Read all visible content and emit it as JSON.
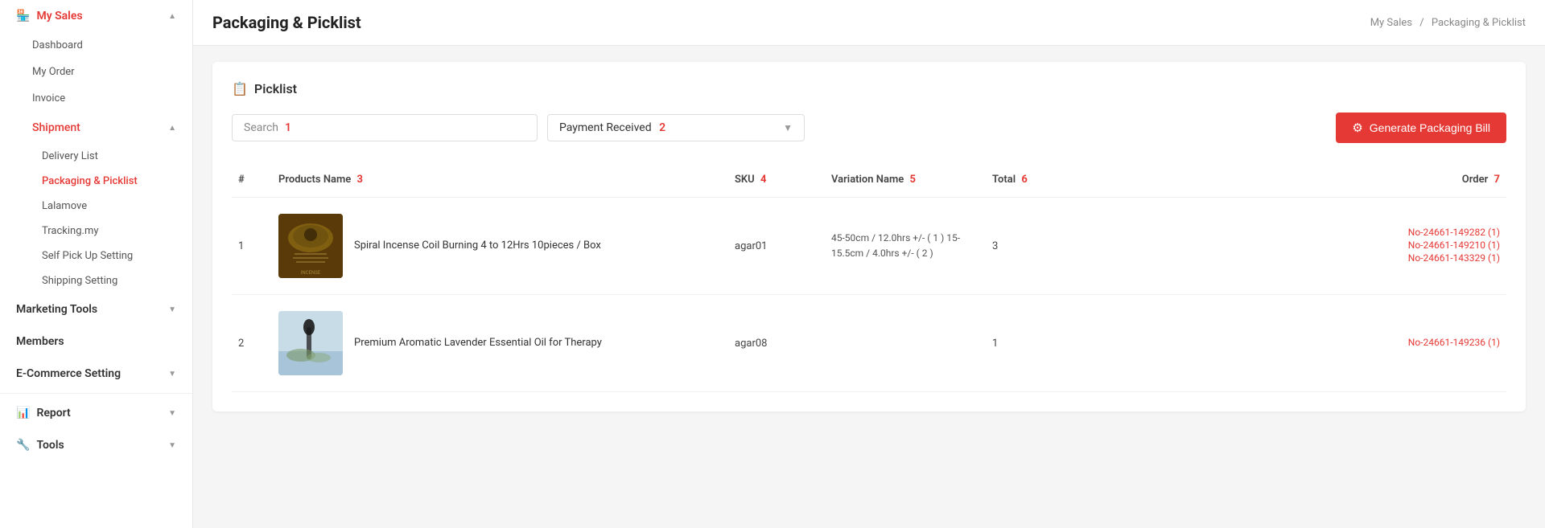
{
  "sidebar": {
    "my_sales_label": "My Sales",
    "items": [
      {
        "id": "dashboard",
        "label": "Dashboard",
        "level": 1
      },
      {
        "id": "my-order",
        "label": "My Order",
        "level": 1
      },
      {
        "id": "invoice",
        "label": "Invoice",
        "level": 1
      },
      {
        "id": "shipment",
        "label": "Shipment",
        "level": 1,
        "expanded": true
      },
      {
        "id": "delivery-list",
        "label": "Delivery List",
        "level": 2
      },
      {
        "id": "packaging-picklist",
        "label": "Packaging & Picklist",
        "level": 2,
        "active": true
      },
      {
        "id": "lalamove",
        "label": "Lalamove",
        "level": 2
      },
      {
        "id": "tracking-my",
        "label": "Tracking.my",
        "level": 2
      },
      {
        "id": "self-pick-up",
        "label": "Self Pick Up Setting",
        "level": 2
      },
      {
        "id": "shipping-setting",
        "label": "Shipping Setting",
        "level": 2
      },
      {
        "id": "marketing-tools",
        "label": "Marketing Tools",
        "level": 1
      },
      {
        "id": "members",
        "label": "Members",
        "level": 1
      },
      {
        "id": "ecommerce-setting",
        "label": "E-Commerce Setting",
        "level": 1
      },
      {
        "id": "report",
        "label": "Report",
        "level": 1
      },
      {
        "id": "tools",
        "label": "Tools",
        "level": 1
      }
    ]
  },
  "header": {
    "title": "Packaging & Picklist",
    "breadcrumb_home": "My Sales",
    "breadcrumb_sep": "/",
    "breadcrumb_current": "Packaging & Picklist"
  },
  "picklist": {
    "section_label": "Picklist",
    "search_placeholder": "Search",
    "search_num": "1",
    "dropdown_value": "Payment Received",
    "dropdown_num": "2",
    "generate_btn_label": "Generate Packaging Bill",
    "table": {
      "columns": [
        "#",
        "Products Name",
        "SKU",
        "Variation Name",
        "Total",
        "Order"
      ],
      "col_nums": [
        "3",
        "4",
        "5",
        "6",
        "7"
      ],
      "rows": [
        {
          "num": "1",
          "product_name": "Spiral Incense Coil Burning 4 to 12Hrs 10pieces / Box",
          "sku": "agar01",
          "variation": "45-50cm / 12.0hrs +/- ( 1 ) 15-15.5cm / 4.0hrs +/- ( 2 )",
          "total": "3",
          "orders": [
            {
              "label": "No-24661-149282 (1)"
            },
            {
              "label": "No-24661-149210 (1)"
            },
            {
              "label": "No-24661-143329 (1)"
            }
          ],
          "img_type": "incense"
        },
        {
          "num": "2",
          "product_name": "Premium Aromatic Lavender Essential Oil for Therapy",
          "sku": "agar08",
          "variation": "",
          "total": "1",
          "orders": [
            {
              "label": "No-24661-149236 (1)"
            }
          ],
          "img_type": "lavender"
        }
      ]
    }
  }
}
